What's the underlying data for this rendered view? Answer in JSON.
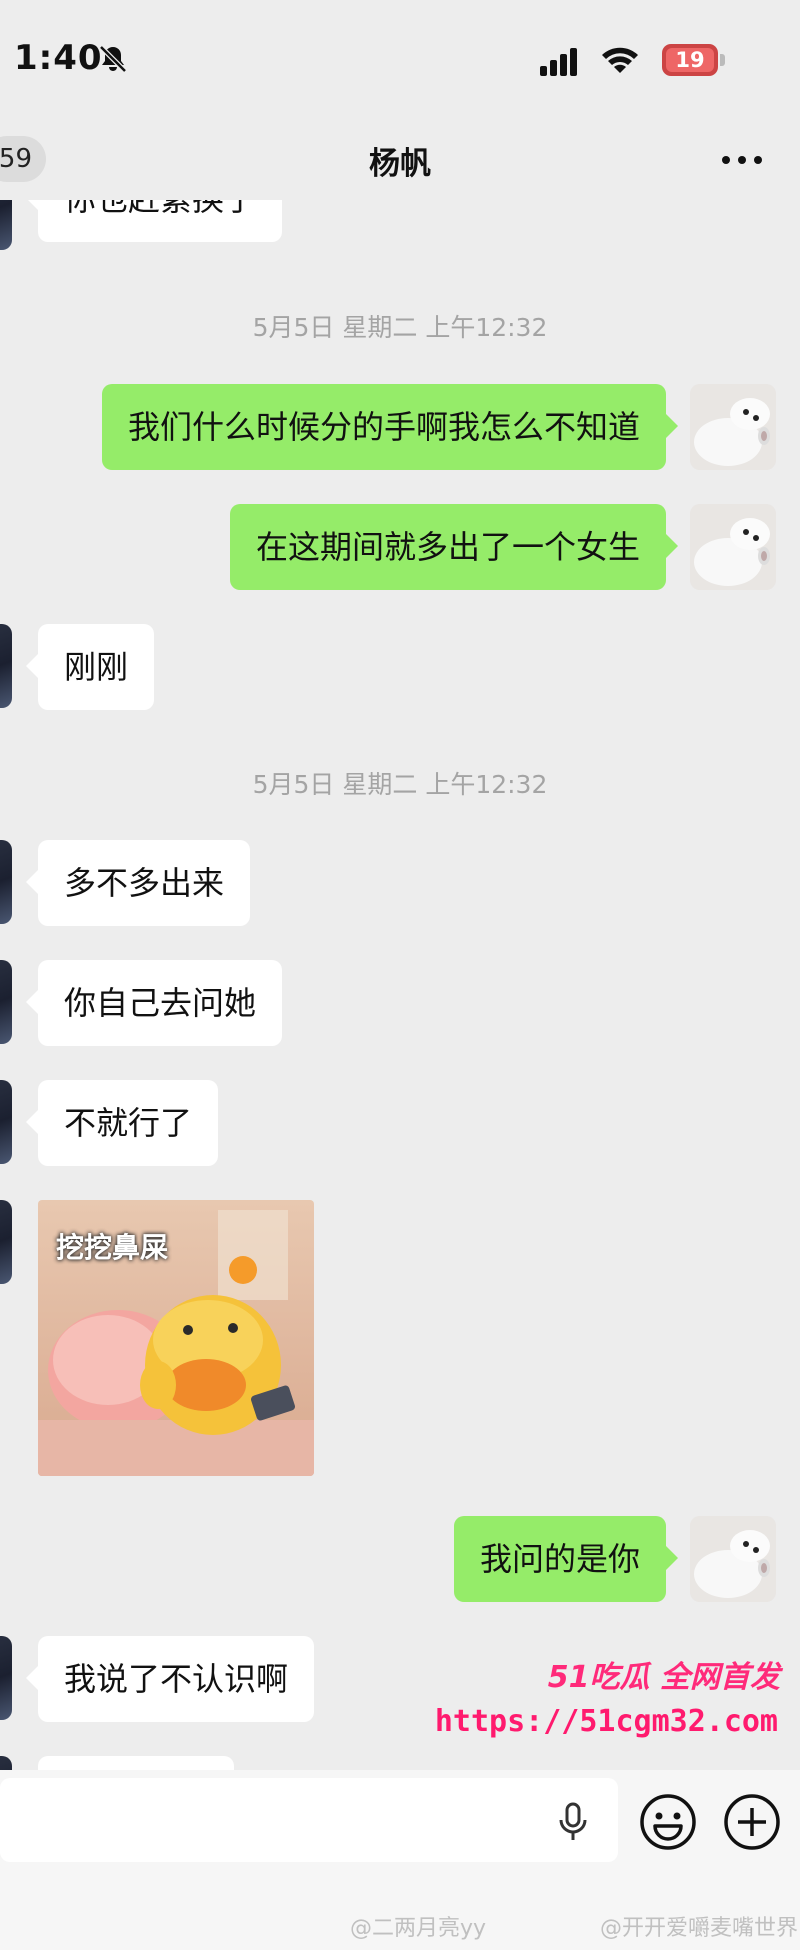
{
  "status_bar": {
    "time": "1:40",
    "battery_level": "19"
  },
  "nav": {
    "unread_count": "59",
    "title": "杨帆"
  },
  "messages": {
    "partial_top": "你也赶紧换了",
    "timestamp1": "5月5日 星期二 上午12:32",
    "sent1": "我们什么时候分的手啊我怎么不知道",
    "sent2": "在这期间就多出了一个女生",
    "recv1": "刚刚",
    "timestamp2": "5月5日 星期二 上午12:32",
    "recv2": "多不多出来",
    "recv3": "你自己去问她",
    "recv4": "不就行了",
    "sticker_caption": "挖挖鼻屎",
    "sent3": "我问的是你",
    "recv5": "我说了不认识啊"
  },
  "watermark": {
    "brand": "51吃瓜 全网首发",
    "url": "https://51cgm32.com"
  },
  "footer": {
    "credit1": "@二两月亮yy",
    "credit2": "@开开爱嚼麦嘴世界"
  },
  "colors": {
    "sent_bubble": "#95ec69",
    "recv_bubble": "#ffffff",
    "background": "#ededed",
    "watermark": "#ff1a6e"
  }
}
